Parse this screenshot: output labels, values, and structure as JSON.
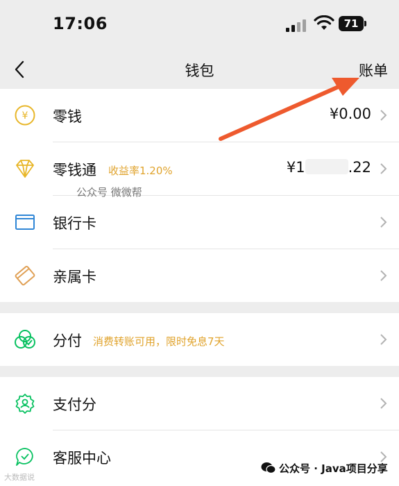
{
  "status_bar": {
    "time": "17:06",
    "battery": "71"
  },
  "nav": {
    "title": "钱包",
    "bill_link": "账单"
  },
  "rows": {
    "change": {
      "label": "零钱",
      "value": "¥0.00"
    },
    "wallet_plus": {
      "label": "零钱通",
      "tag": "收益率1.20%",
      "value_prefix": "¥1",
      "value_suffix": ".22"
    },
    "bank_card": {
      "label": "银行卡"
    },
    "family_card": {
      "label": "亲属卡"
    },
    "fenfu": {
      "label": "分付",
      "tag": "消费转账可用，限时免息7天"
    },
    "pay_score": {
      "label": "支付分"
    },
    "service": {
      "label": "客服中心"
    }
  },
  "watermarks": {
    "public_account": "公众号 微微帮",
    "bottom_right": "公众号 · Java项目分享",
    "bottom_left": "大数据说"
  },
  "colors": {
    "accent_orange": "#ee5a2e",
    "green": "#07c160",
    "gold": "#e0a32c",
    "blue": "#2f86d6"
  }
}
